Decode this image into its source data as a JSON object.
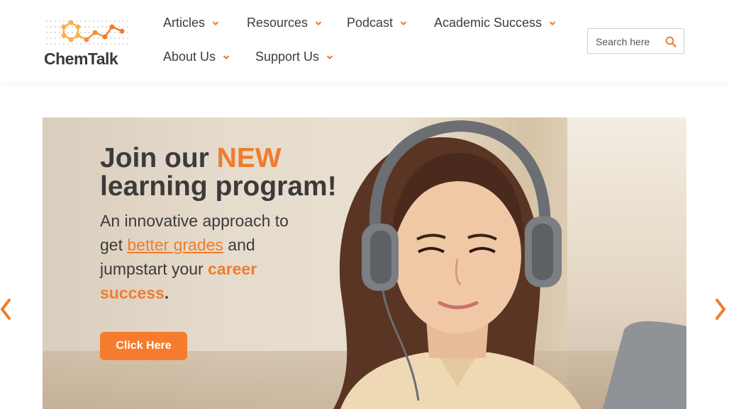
{
  "brand": {
    "logo_text_chem": "Chem",
    "logo_text_talk": "Talk",
    "accent": "#f57c2e"
  },
  "nav": {
    "items": [
      {
        "label": "Articles"
      },
      {
        "label": "Resources"
      },
      {
        "label": "Podcast"
      },
      {
        "label": "Academic Success"
      },
      {
        "label": "About Us"
      },
      {
        "label": "Support Us"
      }
    ]
  },
  "search": {
    "placeholder": "Search here",
    "icon": "search-icon"
  },
  "hero": {
    "title_prefix": "Join our ",
    "title_new": "NEW",
    "title_suffix": "learning program!",
    "sub_1": "An innovative approach to get ",
    "sub_link": "better grades",
    "sub_2": " and jumpstart your ",
    "sub_bold": "career success",
    "sub_end": ".",
    "cta_label": "Click Here"
  },
  "carousel": {
    "prev_icon": "chevron-left-icon",
    "next_icon": "chevron-right-icon"
  }
}
